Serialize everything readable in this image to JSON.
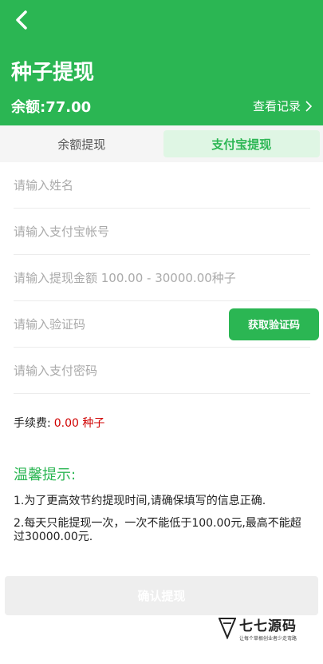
{
  "header": {
    "title": "种子提现",
    "balance": "余额:77.00",
    "records_link": "查看记录",
    "back_icon": "chevron-left-icon",
    "records_icon": "chevron-right-icon",
    "bg_color": "#2bb653"
  },
  "tabs": [
    {
      "label": "余额提现",
      "active": false
    },
    {
      "label": "支付宝提现",
      "active": true
    }
  ],
  "form": {
    "name_placeholder": "请输入姓名",
    "account_placeholder": "请输入支付宝帐号",
    "amount_placeholder": "请输入提现金额 100.00 - 30000.00种子",
    "code_placeholder": "请输入验证码",
    "code_button": "获取验证码",
    "password_placeholder": "请输入支付密码"
  },
  "fee": {
    "label": "手续费:",
    "value": "0.00 种子"
  },
  "tips": {
    "title": "温馨提示:",
    "items": [
      "1.为了更高效节约提现时间,请确保填写的信息正确.",
      "2.每天只能提现一次，一次不能低于100.00元,最高不能超过30000.00元."
    ]
  },
  "confirm_button": "确认提现",
  "watermark": {
    "name": "七七源码",
    "slogan": "让每个草根创业者少走弯路"
  }
}
